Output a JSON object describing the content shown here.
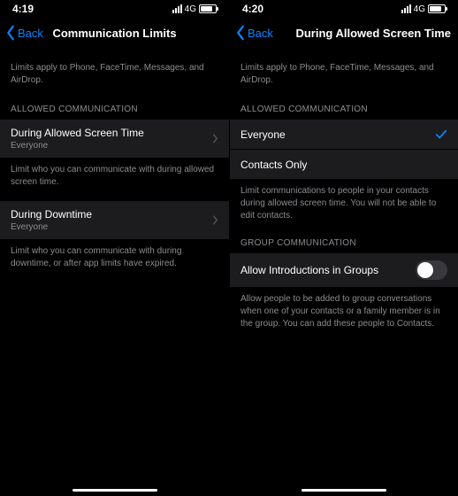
{
  "left": {
    "status": {
      "time": "4:19",
      "cell": "4G"
    },
    "nav": {
      "back": "Back",
      "title": "Communication Limits"
    },
    "intro": "Limits apply to Phone, FaceTime, Messages, and AirDrop.",
    "section1_header": "ALLOWED COMMUNICATION",
    "cell1": {
      "title": "During Allowed Screen Time",
      "subtitle": "Everyone"
    },
    "footer1": "Limit who you can communicate with during allowed screen time.",
    "cell2": {
      "title": "During Downtime",
      "subtitle": "Everyone"
    },
    "footer2": "Limit who you can communicate with during downtime, or after app limits have expired."
  },
  "right": {
    "status": {
      "time": "4:20",
      "cell": "4G"
    },
    "nav": {
      "back": "Back",
      "title": "During Allowed Screen Time"
    },
    "intro": "Limits apply to Phone, FaceTime, Messages, and AirDrop.",
    "section1_header": "ALLOWED COMMUNICATION",
    "option1": "Everyone",
    "option2": "Contacts Only",
    "footer1": "Limit communications to people in your contacts during allowed screen time. You will not be able to edit contacts.",
    "section2_header": "GROUP COMMUNICATION",
    "toggle_label": "Allow Introductions in Groups",
    "footer2": "Allow people to be added to group conversations when one of your contacts or a family member is in the group. You can add these people to Contacts."
  }
}
